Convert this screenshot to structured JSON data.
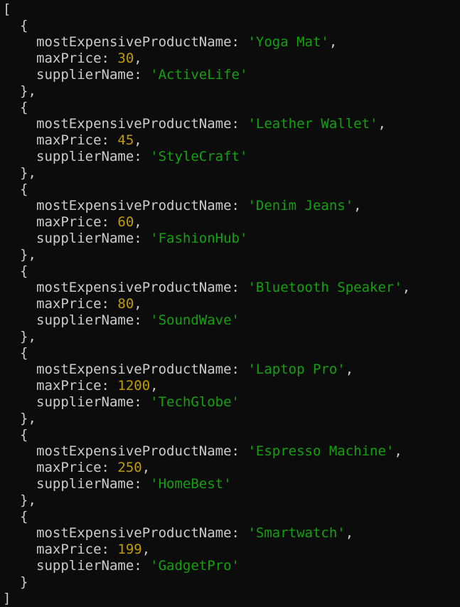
{
  "output": {
    "open_bracket": "[",
    "close_bracket": "]",
    "key_product": "mostExpensiveProductName",
    "key_price": "maxPrice",
    "key_supplier": "supplierName",
    "records": [
      {
        "product": "'Yoga Mat'",
        "price": "30",
        "supplier": "'ActiveLife'",
        "close": "},"
      },
      {
        "product": "'Leather Wallet'",
        "price": "45",
        "supplier": "'StyleCraft'",
        "close": "},"
      },
      {
        "product": "'Denim Jeans'",
        "price": "60",
        "supplier": "'FashionHub'",
        "close": "},"
      },
      {
        "product": "'Bluetooth Speaker'",
        "price": "80",
        "supplier": "'SoundWave'",
        "close": "},"
      },
      {
        "product": "'Laptop Pro'",
        "price": "1200",
        "supplier": "'TechGlobe'",
        "close": "},"
      },
      {
        "product": "'Espresso Machine'",
        "price": "250",
        "supplier": "'HomeBest'",
        "close": "},"
      },
      {
        "product": "'Smartwatch'",
        "price": "199",
        "supplier": "'GadgetPro'",
        "close": "}"
      }
    ]
  },
  "colors": {
    "background": "#0c0c0c",
    "text": "#cccccc",
    "string": "#13a10e",
    "number": "#c19c00"
  }
}
